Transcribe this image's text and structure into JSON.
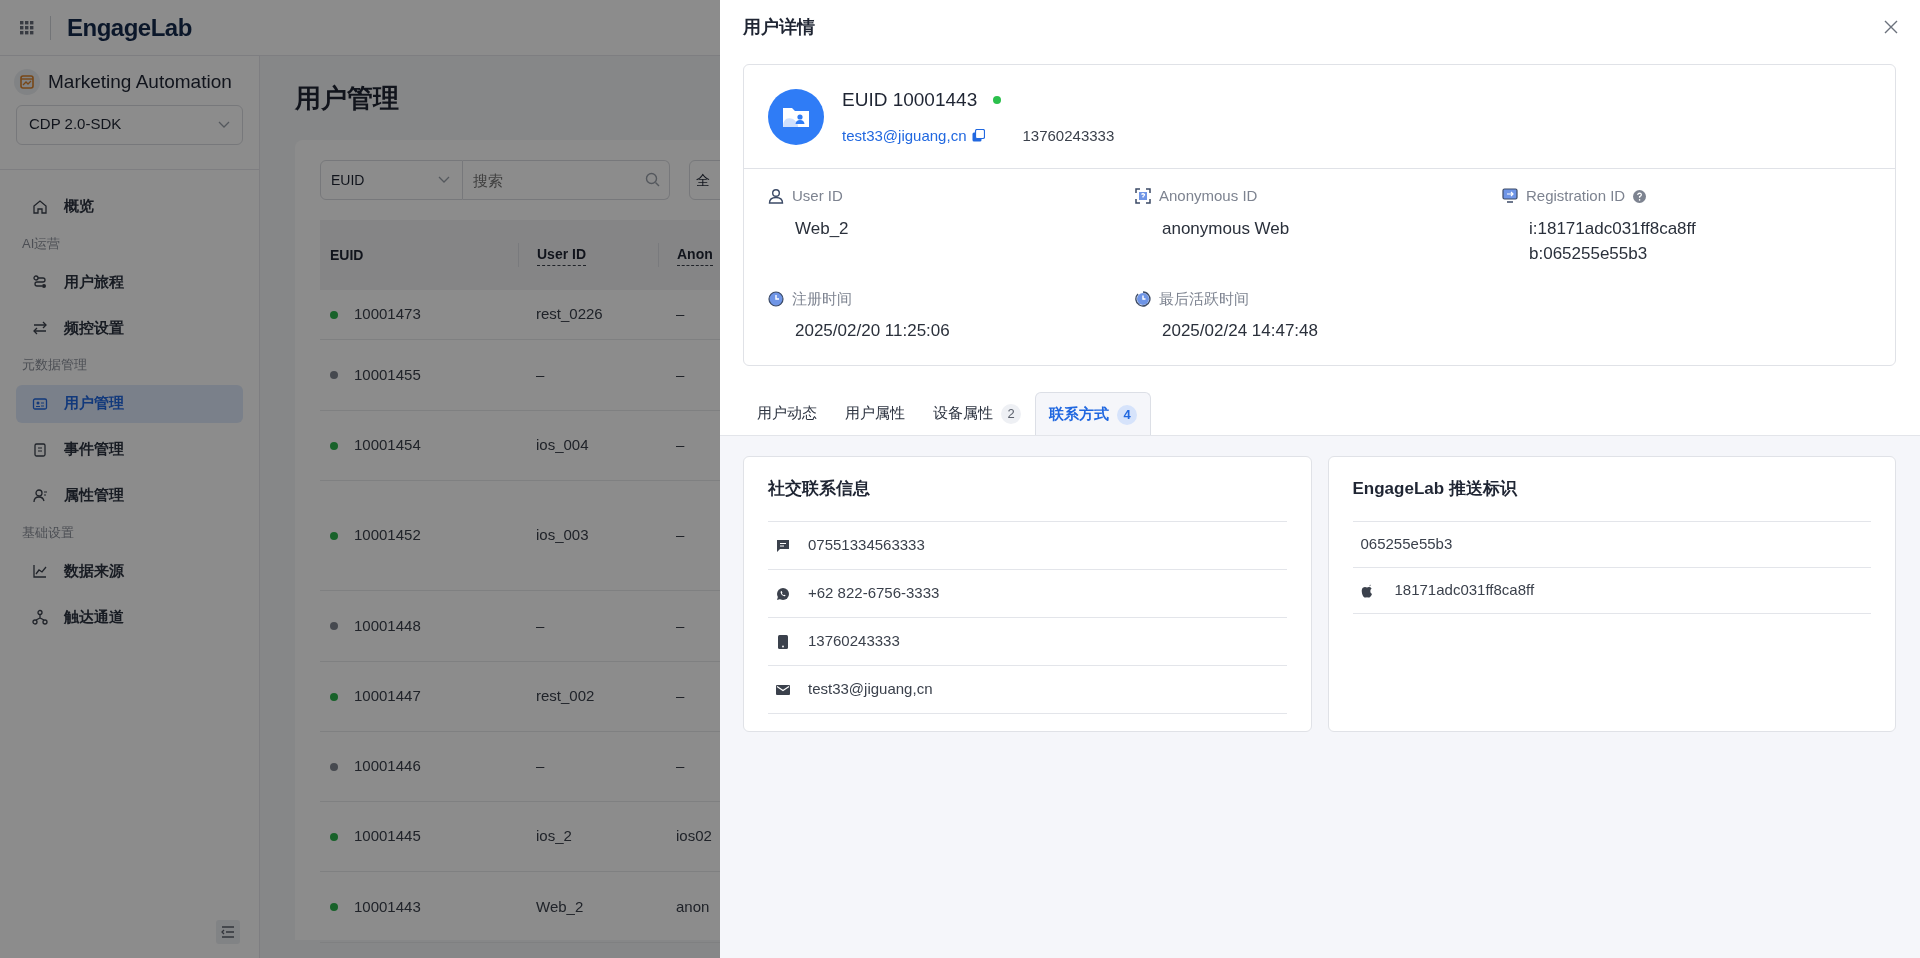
{
  "header": {
    "logo": "EngageLab"
  },
  "sidebar": {
    "product": "Marketing Automation",
    "project_select": "CDP 2.0-SDK",
    "items": [
      {
        "kind": "item",
        "label": "概览",
        "selected": false
      },
      {
        "kind": "section",
        "label": "AI运营"
      },
      {
        "kind": "item",
        "label": "用户旅程",
        "selected": false
      },
      {
        "kind": "item",
        "label": "频控设置",
        "selected": false
      },
      {
        "kind": "section",
        "label": "元数据管理"
      },
      {
        "kind": "item",
        "label": "用户管理",
        "selected": true
      },
      {
        "kind": "item",
        "label": "事件管理",
        "selected": false
      },
      {
        "kind": "item",
        "label": "属性管理",
        "selected": false
      },
      {
        "kind": "section",
        "label": "基础设置"
      },
      {
        "kind": "item",
        "label": "数据来源",
        "selected": false
      },
      {
        "kind": "item",
        "label": "触达通道",
        "selected": false
      }
    ]
  },
  "page": {
    "title": "用户管理",
    "filter": {
      "field_select": "EUID",
      "search_placeholder": "搜索",
      "column_3": "全"
    },
    "table": {
      "columns": [
        "EUID",
        "User ID",
        "Anon"
      ],
      "rows": [
        {
          "euid": "10001473",
          "color": "#18622a",
          "user_id": "rest_0226",
          "column_3": "–"
        },
        {
          "euid": "10001455",
          "color": "#46494f",
          "user_id": "–",
          "column_3": "–"
        },
        {
          "euid": "10001454",
          "color": "#18622a",
          "user_id": "ios_004",
          "column_3": "–"
        },
        {
          "euid": "10001452",
          "color": "#18622a",
          "user_id": "ios_003",
          "column_3": "–"
        },
        {
          "euid": "10001448",
          "color": "#46494f",
          "user_id": "–",
          "column_3": "–"
        },
        {
          "euid": "10001447",
          "color": "#18622a",
          "user_id": "rest_002",
          "column_3": "–"
        },
        {
          "euid": "10001446",
          "color": "#46494f",
          "user_id": "–",
          "column_3": "–"
        },
        {
          "euid": "10001445",
          "color": "#18622a",
          "user_id": "ios_2",
          "column_3": "ios02"
        },
        {
          "euid": "10001443",
          "color": "#18622a",
          "user_id": "Web_2",
          "column_3": "anon"
        }
      ]
    }
  },
  "drawer": {
    "title": "用户详情",
    "user": {
      "euid": "EUID 10001443",
      "online": true,
      "email": "test33@jiguang,cn",
      "phone": "13760243333"
    },
    "fields": [
      {
        "label": "User ID",
        "values": [
          "Web_2"
        ]
      },
      {
        "label": "Anonymous ID",
        "values": [
          "anonymous Web"
        ]
      },
      {
        "label": "Registration ID",
        "help": true,
        "values": [
          "i:18171adc031ff8ca8ff",
          "b:065255e55b3"
        ]
      },
      {
        "label": "注册时间",
        "values": [
          "2025/02/20 11:25:06"
        ]
      },
      {
        "label": "最后活跃时间",
        "values": [
          "2025/02/24 14:47:48"
        ]
      }
    ],
    "tabs": [
      {
        "label": "用户动态",
        "selected": false
      },
      {
        "label": "用户属性",
        "selected": false
      },
      {
        "label": "设备属性",
        "count": "2",
        "selected": false
      },
      {
        "label": "联系方式",
        "count": "4",
        "selected": true
      }
    ],
    "social": {
      "title": "社交联系信息",
      "items": [
        {
          "kind": "sms",
          "value": "07551334563333"
        },
        {
          "kind": "whatsapp",
          "value": "+62 822-6756-3333"
        },
        {
          "kind": "phone",
          "value": "13760243333"
        },
        {
          "kind": "email",
          "value": "test33@jiguang,cn"
        }
      ]
    },
    "push": {
      "title": "EngageLab 推送标识",
      "items": [
        {
          "kind": "plain",
          "value": "065255e55b3"
        },
        {
          "kind": "ios",
          "value": "18171adc031ff8ca8ff"
        }
      ]
    }
  }
}
